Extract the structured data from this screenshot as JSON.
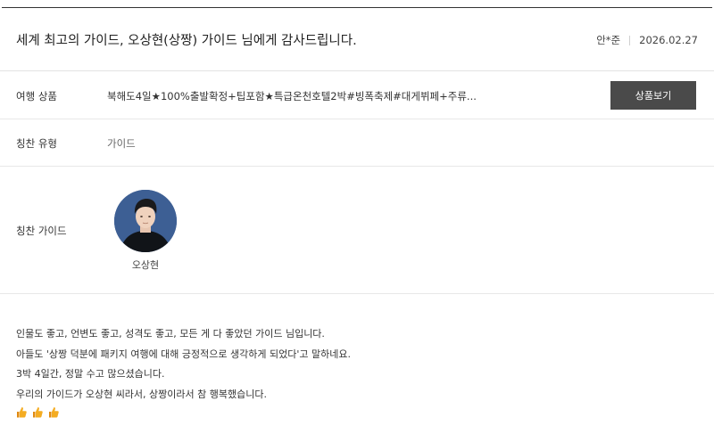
{
  "header": {
    "title": "세계 최고의 가이드, 오상현(상짱) 가이드 님에게 감사드립니다.",
    "author": "안*준",
    "date": "2026.02.27"
  },
  "product": {
    "label": "여행 상품",
    "name": "북해도4일★100%출발확정+팁포함★특급온천호텔2박#빙폭축제#대게뷔페+주류...",
    "button_label": "상품보기"
  },
  "praise_type": {
    "label": "칭찬 유형",
    "value": "가이드"
  },
  "guide": {
    "label": "칭찬 가이드",
    "name": "오상현"
  },
  "review": {
    "lines": [
      "인물도 좋고, 언변도 좋고, 성격도 좋고, 모든 게 다 좋았던 가이드 님입니다.",
      "아들도 '상짱 덕분에 패키지 여행에 대해 긍정적으로 생각하게 되었다'고 말하네요.",
      "3박 4일간, 정말 수고 많으셨습니다.",
      "우리의 가이드가 오상현 씨라서, 상짱이라서 참 행복했습니다."
    ],
    "emoji": [
      "thumbs-up-icon",
      "thumbs-up-icon",
      "thumbs-up-icon"
    ]
  },
  "colors": {
    "button_bg": "#4a4a4a",
    "thumb": "#f2a71b"
  }
}
